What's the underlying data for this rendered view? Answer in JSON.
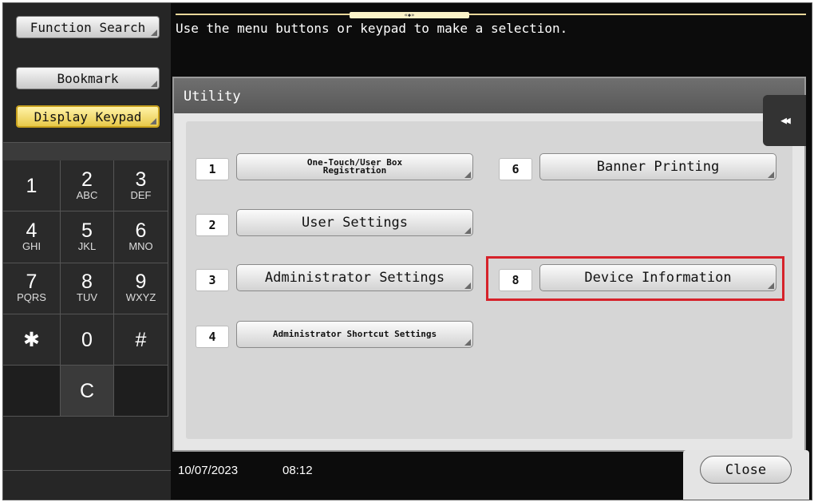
{
  "left_menu": {
    "function_search": "Function Search",
    "bookmark": "Bookmark",
    "display_keypad": "Display Keypad"
  },
  "keypad": [
    {
      "digit": "1",
      "letters": ""
    },
    {
      "digit": "2",
      "letters": "ABC"
    },
    {
      "digit": "3",
      "letters": "DEF"
    },
    {
      "digit": "4",
      "letters": "GHI"
    },
    {
      "digit": "5",
      "letters": "JKL"
    },
    {
      "digit": "6",
      "letters": "MNO"
    },
    {
      "digit": "7",
      "letters": "PQRS"
    },
    {
      "digit": "8",
      "letters": "TUV"
    },
    {
      "digit": "9",
      "letters": "WXYZ"
    },
    {
      "digit": "✱",
      "letters": ""
    },
    {
      "digit": "0",
      "letters": ""
    },
    {
      "digit": "#",
      "letters": ""
    },
    {
      "digit": "C",
      "letters": ""
    }
  ],
  "message": "Use the menu buttons or keypad to make a selection.",
  "handle_glyph": "«◆»",
  "panel": {
    "title": "Utility",
    "collapse_glyph": "◀◀",
    "items": [
      {
        "num": "1",
        "label": "One-Touch/User Box Registration"
      },
      {
        "num": "2",
        "label": "User Settings"
      },
      {
        "num": "3",
        "label": "Administrator Settings"
      },
      {
        "num": "4",
        "label": "Administrator Shortcut Settings"
      },
      {
        "num": "6",
        "label": "Banner Printing"
      },
      {
        "num": "8",
        "label": "Device Information"
      }
    ]
  },
  "status": {
    "date": "10/07/2023",
    "time": "08:12"
  },
  "close_label": "Close",
  "colors": {
    "highlight": "#d6222a",
    "active_button": "#e8c94a"
  }
}
